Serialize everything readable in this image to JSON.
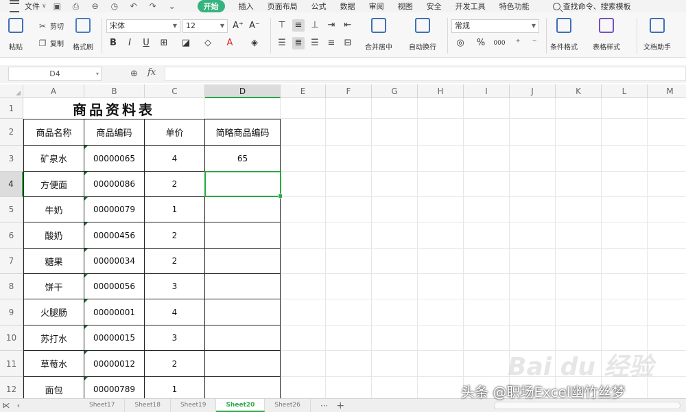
{
  "menu": {
    "file": "文件",
    "quick_icons": [
      "save-icon",
      "print-icon",
      "print-preview-icon",
      "export-pdf-icon",
      "undo-icon",
      "redo-icon",
      "customize-icon"
    ],
    "tabs": [
      "开始",
      "插入",
      "页面布局",
      "公式",
      "数据",
      "审阅",
      "视图",
      "安全",
      "开发工具",
      "特色功能"
    ],
    "active_tab": "开始",
    "search": "查找命令、搜索模板"
  },
  "ribbon": {
    "paste": "粘贴",
    "cut": "剪切",
    "copy": "复制",
    "format_painter": "格式刷",
    "font_name": "宋体",
    "font_size": "12",
    "grow_font": "A⁺",
    "shrink_font": "A⁻",
    "bold": "B",
    "italic": "I",
    "underline": "U",
    "merge_center": "合并居中",
    "wrap_text": "自动换行",
    "number_format": "常规",
    "percent": "%",
    "thousands": "000",
    "conditional_format": "条件格式",
    "table_style": "表格样式",
    "doc_helper": "文档助手"
  },
  "formula_bar": {
    "name_box": "D4",
    "fx": "fx",
    "formula": ""
  },
  "grid": {
    "columns": [
      "A",
      "B",
      "C",
      "D",
      "E",
      "F",
      "G",
      "H",
      "I",
      "J",
      "K",
      "L",
      "M"
    ],
    "rows": [
      "1",
      "2",
      "3",
      "4",
      "5",
      "6",
      "7",
      "8",
      "9",
      "10",
      "11",
      "12"
    ],
    "active_column": "D",
    "active_row": "4",
    "title": "商品资料表",
    "headers": [
      "商品名称",
      "商品编码",
      "单价",
      "简略商品编码"
    ],
    "data": [
      {
        "name": "矿泉水",
        "code": "00000065",
        "price": "4",
        "short": "65"
      },
      {
        "name": "方便面",
        "code": "00000086",
        "price": "2",
        "short": ""
      },
      {
        "name": "牛奶",
        "code": "00000079",
        "price": "1",
        "short": ""
      },
      {
        "name": "酸奶",
        "code": "00000456",
        "price": "2",
        "short": ""
      },
      {
        "name": "糖果",
        "code": "00000034",
        "price": "2",
        "short": ""
      },
      {
        "name": "饼干",
        "code": "00000056",
        "price": "3",
        "short": ""
      },
      {
        "name": "火腿肠",
        "code": "00000001",
        "price": "4",
        "short": ""
      },
      {
        "name": "苏打水",
        "code": "00000015",
        "price": "3",
        "short": ""
      },
      {
        "name": "草莓水",
        "code": "00000012",
        "price": "2",
        "short": ""
      },
      {
        "name": "面包",
        "code": "00000789",
        "price": "1",
        "short": ""
      }
    ]
  },
  "sheets": {
    "tabs": [
      "Sheet17",
      "Sheet18",
      "Sheet19",
      "Sheet20",
      "Sheet26"
    ],
    "active": "Sheet20",
    "more": "···",
    "add": "+"
  },
  "watermark": {
    "text": "头条 @职场Excel幽竹丝梦",
    "logo": "Bai du 经验"
  }
}
